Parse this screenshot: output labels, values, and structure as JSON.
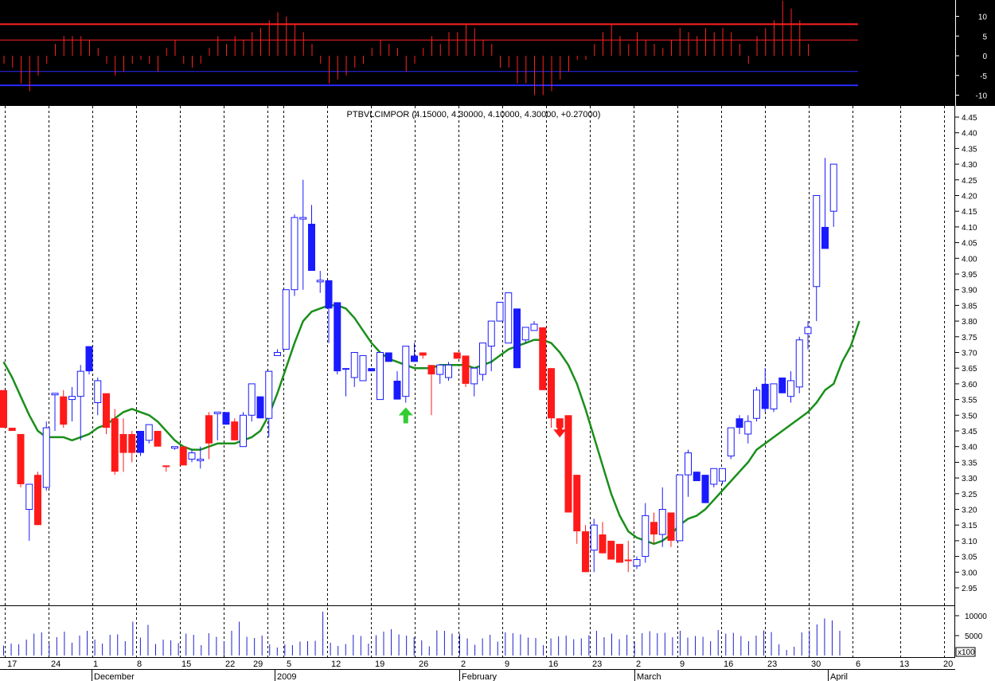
{
  "chart_data": [
    {
      "type": "bar",
      "panel": "oscillator",
      "background": "#000000",
      "ylim": [
        -12,
        13
      ],
      "yticks": [
        "10",
        "5",
        "0",
        "-5",
        "-10"
      ],
      "yticks_values": [
        10,
        5,
        0,
        -5,
        -10
      ],
      "reference_lines": [
        {
          "value": 8,
          "color": "#ff2020"
        },
        {
          "value": 4,
          "color": "#ff2020"
        },
        {
          "value": -4,
          "color": "#2a2aff"
        },
        {
          "value": -7.5,
          "color": "#2a2aff"
        }
      ],
      "bar_color": "#ff2020",
      "values": [
        -2,
        -3,
        -7,
        -9,
        -5,
        -2,
        3,
        5,
        5,
        5,
        4,
        2,
        -2,
        -5,
        -4,
        -2,
        -1,
        -2,
        -4,
        2,
        4,
        -2,
        -3,
        -2,
        2,
        5,
        3,
        5,
        4,
        6,
        7,
        9,
        11,
        10,
        8,
        6,
        3,
        -2,
        -7,
        -6,
        -5,
        -3,
        -2,
        2,
        4,
        3,
        2,
        -4,
        -2,
        2,
        5,
        3,
        6,
        6,
        8,
        7,
        4,
        3,
        -3,
        -3,
        -7,
        -7,
        -10,
        -10,
        -9,
        -6,
        -4,
        -1,
        -1,
        3,
        6,
        8,
        5,
        3,
        6,
        4,
        3,
        2,
        4,
        7,
        6,
        5,
        7,
        6,
        7,
        6,
        3,
        -2,
        5,
        7,
        9,
        14,
        12,
        9,
        3
      ]
    },
    {
      "type": "candlestick",
      "panel": "price",
      "title": "PTBVLCIMPOR (4.15000, 4.30000, 4.10000, 4.30000, +0.27000)",
      "ylim": [
        2.905,
        4.46
      ],
      "yticks": [
        "4.45",
        "4.40",
        "4.35",
        "4.30",
        "4.25",
        "4.20",
        "4.15",
        "4.10",
        "4.05",
        "4.00",
        "3.95",
        "3.90",
        "3.85",
        "3.80",
        "3.75",
        "3.70",
        "3.65",
        "3.60",
        "3.55",
        "3.50",
        "3.45",
        "3.40",
        "3.35",
        "3.30",
        "3.25",
        "3.20",
        "3.15",
        "3.10",
        "3.05",
        "3.00",
        "2.95"
      ],
      "yticks_values": [
        4.45,
        4.4,
        4.35,
        4.3,
        4.25,
        4.2,
        4.15,
        4.1,
        4.05,
        4.0,
        3.95,
        3.9,
        3.85,
        3.8,
        3.75,
        3.7,
        3.65,
        3.6,
        3.55,
        3.5,
        3.45,
        3.4,
        3.35,
        3.3,
        3.25,
        3.2,
        3.15,
        3.1,
        3.05,
        3.0,
        2.95
      ],
      "colors": {
        "down": "#ff1a1a",
        "up_filled": "#1a1aff",
        "hollow_border": "#1a1aff",
        "ma": "#1a8f1a",
        "buy_arrow": "#33cc33",
        "sell_arrow": "#ff1a1a"
      },
      "candles": [
        [
          3.58,
          3.58,
          3.46,
          3.46,
          "down"
        ],
        [
          3.46,
          3.46,
          3.45,
          3.45,
          "down"
        ],
        [
          3.44,
          3.44,
          3.27,
          3.28,
          "down"
        ],
        [
          3.2,
          3.28,
          3.1,
          3.28,
          "hollow"
        ],
        [
          3.31,
          3.32,
          3.15,
          3.15,
          "down"
        ],
        [
          3.27,
          3.48,
          3.26,
          3.46,
          "hollow"
        ],
        [
          3.57,
          3.57,
          3.45,
          3.57,
          "hollow"
        ],
        [
          3.56,
          3.58,
          3.46,
          3.47,
          "down"
        ],
        [
          3.55,
          3.59,
          3.48,
          3.56,
          "hollow"
        ],
        [
          3.56,
          3.66,
          3.42,
          3.64,
          "hollow"
        ],
        [
          3.64,
          3.72,
          3.63,
          3.72,
          "up_filled"
        ],
        [
          3.54,
          3.62,
          3.5,
          3.61,
          "hollow"
        ],
        [
          3.57,
          3.57,
          3.44,
          3.46,
          "down"
        ],
        [
          3.49,
          3.52,
          3.31,
          3.32,
          "down"
        ],
        [
          3.44,
          3.49,
          3.32,
          3.38,
          "down"
        ],
        [
          3.44,
          3.45,
          3.35,
          3.38,
          "down"
        ],
        [
          3.38,
          3.45,
          3.37,
          3.45,
          "up_filled"
        ],
        [
          3.42,
          3.47,
          3.41,
          3.47,
          "hollow"
        ],
        [
          3.45,
          3.45,
          3.4,
          3.4,
          "down"
        ],
        [
          3.34,
          3.34,
          3.32,
          3.34,
          "down"
        ],
        [
          3.4,
          3.4,
          3.39,
          3.4,
          "hollow"
        ],
        [
          3.4,
          3.4,
          3.34,
          3.34,
          "down"
        ],
        [
          3.36,
          3.39,
          3.35,
          3.38,
          "hollow"
        ],
        [
          3.36,
          3.4,
          3.33,
          3.36,
          "hollow"
        ],
        [
          3.41,
          3.51,
          3.36,
          3.5,
          "down"
        ],
        [
          3.51,
          3.51,
          3.42,
          3.51,
          "hollow"
        ],
        [
          3.51,
          3.51,
          3.47,
          3.47,
          "up_filled"
        ],
        [
          3.48,
          3.49,
          3.42,
          3.42,
          "down"
        ],
        [
          3.4,
          3.51,
          3.4,
          3.5,
          "hollow"
        ],
        [
          3.5,
          3.6,
          3.48,
          3.6,
          "hollow"
        ],
        [
          3.56,
          3.56,
          3.49,
          3.49,
          "up_filled"
        ],
        [
          3.49,
          3.64,
          3.43,
          3.64,
          "hollow"
        ],
        [
          3.69,
          3.71,
          3.69,
          3.7,
          "hollow"
        ],
        [
          3.71,
          3.9,
          3.71,
          3.9,
          "hollow"
        ],
        [
          3.9,
          4.14,
          3.88,
          4.13,
          "hollow"
        ],
        [
          4.13,
          4.25,
          3.9,
          4.13,
          "hollow"
        ],
        [
          4.11,
          4.17,
          3.96,
          3.96,
          "up_filled"
        ],
        [
          3.93,
          3.96,
          3.89,
          3.93,
          "hollow"
        ],
        [
          3.93,
          3.93,
          3.73,
          3.84,
          "up_filled"
        ],
        [
          3.86,
          3.86,
          3.63,
          3.64,
          "up_filled"
        ],
        [
          3.65,
          3.65,
          3.56,
          3.65,
          "up_filled"
        ],
        [
          3.62,
          3.7,
          3.59,
          3.7,
          "hollow"
        ],
        [
          3.69,
          3.69,
          3.61,
          3.61,
          "hollow"
        ],
        [
          3.65,
          3.65,
          3.64,
          3.64,
          "up_filled"
        ],
        [
          3.55,
          3.7,
          3.55,
          3.7,
          "hollow"
        ],
        [
          3.7,
          3.7,
          3.67,
          3.67,
          "up_filled"
        ],
        [
          3.61,
          3.64,
          3.55,
          3.55,
          "up_filled"
        ],
        [
          3.56,
          3.72,
          3.54,
          3.72,
          "hollow"
        ],
        [
          3.67,
          3.73,
          3.67,
          3.69,
          "up_filled"
        ],
        [
          3.69,
          3.7,
          3.68,
          3.7,
          "down"
        ],
        [
          3.66,
          3.66,
          3.5,
          3.63,
          "down"
        ],
        [
          3.63,
          3.65,
          3.6,
          3.66,
          "hollow"
        ],
        [
          3.62,
          3.67,
          3.61,
          3.66,
          "hollow"
        ],
        [
          3.7,
          3.7,
          3.68,
          3.68,
          "down"
        ],
        [
          3.69,
          3.69,
          3.59,
          3.6,
          "down"
        ],
        [
          3.6,
          3.65,
          3.56,
          3.65,
          "hollow"
        ],
        [
          3.63,
          3.73,
          3.61,
          3.73,
          "hollow"
        ],
        [
          3.72,
          3.8,
          3.64,
          3.8,
          "hollow"
        ],
        [
          3.8,
          3.86,
          3.8,
          3.86,
          "hollow"
        ],
        [
          3.73,
          3.89,
          3.73,
          3.89,
          "hollow"
        ],
        [
          3.84,
          3.84,
          3.65,
          3.65,
          "up_filled"
        ],
        [
          3.78,
          3.78,
          3.73,
          3.74,
          "hollow"
        ],
        [
          3.79,
          3.8,
          3.77,
          3.77,
          "hollow"
        ],
        [
          3.78,
          3.78,
          3.58,
          3.58,
          "down"
        ],
        [
          3.65,
          3.65,
          3.46,
          3.49,
          "down"
        ],
        [
          3.49,
          3.49,
          3.45,
          3.46,
          "down"
        ],
        [
          3.5,
          3.5,
          3.19,
          3.19,
          "down"
        ],
        [
          3.31,
          3.31,
          3.09,
          3.13,
          "down"
        ],
        [
          3.13,
          3.15,
          3.0,
          3.0,
          "down"
        ],
        [
          3.07,
          3.17,
          3.0,
          3.15,
          "hollow"
        ],
        [
          3.12,
          3.16,
          3.06,
          3.06,
          "down"
        ],
        [
          3.1,
          3.1,
          3.04,
          3.04,
          "down"
        ],
        [
          3.09,
          3.09,
          3.03,
          3.03,
          "down"
        ],
        [
          3.04,
          3.1,
          3.0,
          3.04,
          "down"
        ],
        [
          3.02,
          3.05,
          3.01,
          3.04,
          "hollow"
        ],
        [
          3.05,
          3.22,
          3.03,
          3.18,
          "hollow"
        ],
        [
          3.16,
          3.19,
          3.09,
          3.12,
          "down"
        ],
        [
          3.12,
          3.27,
          3.08,
          3.2,
          "hollow"
        ],
        [
          3.19,
          3.19,
          3.08,
          3.1,
          "down"
        ],
        [
          3.1,
          3.31,
          3.1,
          3.31,
          "hollow"
        ],
        [
          3.31,
          3.39,
          3.24,
          3.38,
          "hollow"
        ],
        [
          3.32,
          3.32,
          3.29,
          3.29,
          "up_filled"
        ],
        [
          3.31,
          3.31,
          3.22,
          3.22,
          "up_filled"
        ],
        [
          3.28,
          3.33,
          3.27,
          3.33,
          "hollow"
        ],
        [
          3.29,
          3.33,
          3.28,
          3.33,
          "hollow"
        ],
        [
          3.37,
          3.46,
          3.36,
          3.46,
          "hollow"
        ],
        [
          3.49,
          3.5,
          3.44,
          3.46,
          "up_filled"
        ],
        [
          3.44,
          3.5,
          3.41,
          3.48,
          "hollow"
        ],
        [
          3.49,
          3.59,
          3.48,
          3.58,
          "hollow"
        ],
        [
          3.6,
          3.65,
          3.51,
          3.52,
          "up_filled"
        ],
        [
          3.52,
          3.6,
          3.51,
          3.6,
          "hollow"
        ],
        [
          3.57,
          3.62,
          3.57,
          3.62,
          "up_filled"
        ],
        [
          3.56,
          3.64,
          3.54,
          3.61,
          "hollow"
        ],
        [
          3.59,
          3.75,
          3.57,
          3.74,
          "hollow"
        ],
        [
          3.76,
          3.8,
          3.71,
          3.78,
          "hollow"
        ],
        [
          3.91,
          4.2,
          3.8,
          4.2,
          "hollow"
        ],
        [
          4.1,
          4.32,
          4.03,
          4.03,
          "up_filled"
        ],
        [
          4.15,
          4.3,
          4.1,
          4.3,
          "hollow"
        ]
      ],
      "moving_average": [
        3.67,
        3.62,
        3.56,
        3.5,
        3.45,
        3.43,
        3.43,
        3.43,
        3.42,
        3.43,
        3.44,
        3.46,
        3.47,
        3.49,
        3.51,
        3.52,
        3.51,
        3.5,
        3.48,
        3.45,
        3.42,
        3.4,
        3.39,
        3.39,
        3.4,
        3.41,
        3.41,
        3.41,
        3.42,
        3.43,
        3.45,
        3.5,
        3.57,
        3.65,
        3.73,
        3.8,
        3.83,
        3.84,
        3.85,
        3.85,
        3.84,
        3.81,
        3.77,
        3.73,
        3.7,
        3.68,
        3.67,
        3.66,
        3.65,
        3.65,
        3.65,
        3.66,
        3.66,
        3.66,
        3.66,
        3.65,
        3.66,
        3.67,
        3.69,
        3.71,
        3.72,
        3.73,
        3.74,
        3.74,
        3.73,
        3.7,
        3.66,
        3.6,
        3.52,
        3.43,
        3.34,
        3.25,
        3.18,
        3.13,
        3.11,
        3.1,
        3.09,
        3.1,
        3.12,
        3.15,
        3.17,
        3.18,
        3.2,
        3.23,
        3.26,
        3.29,
        3.32,
        3.35,
        3.39,
        3.41,
        3.43,
        3.45,
        3.47,
        3.49,
        3.51,
        3.54,
        3.58,
        3.6,
        3.67,
        3.72,
        3.8
      ],
      "signals": [
        {
          "type": "buy",
          "index": 47,
          "direction": "up"
        },
        {
          "type": "sell",
          "index": 65,
          "direction": "down"
        }
      ]
    },
    {
      "type": "bar",
      "panel": "volume",
      "unit_label": "x100",
      "ylim": [
        0,
        11000
      ],
      "yticks": [
        "10000",
        "5000"
      ],
      "yticks_values": [
        10000,
        5000
      ],
      "bar_color": "#2020d0",
      "values": [
        2500,
        3000,
        2800,
        4000,
        5500,
        5800,
        3000,
        4600,
        6000,
        3200,
        5000,
        6200,
        4000,
        3000,
        5200,
        5300,
        3600,
        8500,
        4500,
        7700,
        2900,
        4000,
        3800,
        3100,
        5500,
        5200,
        2600,
        5600,
        4700,
        3600,
        6200,
        8500,
        4700,
        4400,
        5000,
        2800,
        2000,
        2800,
        2600,
        3500,
        3600,
        3700,
        11000,
        3200,
        2400,
        2900,
        5200,
        4900,
        3000,
        5100,
        6000,
        6600,
        5300,
        5000,
        4600,
        3800,
        2300,
        6300,
        6200,
        5500,
        5400,
        4300,
        2700,
        4300,
        5200,
        3500,
        5800,
        5600,
        5300,
        4500,
        4400,
        2600,
        4300,
        4800,
        5000,
        4100,
        4300,
        5100,
        6200,
        4600,
        5500,
        4100,
        5200,
        3500,
        5600,
        6100,
        5600,
        5700,
        4600,
        6200,
        4500,
        4900,
        4700,
        3600,
        6400,
        5500,
        5700,
        4900,
        3600,
        5000,
        6300,
        5900,
        2800,
        1400,
        2200,
        5800,
        6300,
        7800,
        9300,
        8800,
        6200
      ]
    }
  ],
  "x_axis": {
    "day_labels": [
      "17",
      "24",
      "1",
      "8",
      "15",
      "22",
      "29",
      "5",
      "12",
      "19",
      "26",
      "2",
      "9",
      "16",
      "23",
      "2",
      "9",
      "16",
      "23",
      "30",
      "6",
      "13",
      "20"
    ],
    "month_labels": [
      "December",
      "2009",
      "February",
      "March",
      "April"
    ]
  }
}
